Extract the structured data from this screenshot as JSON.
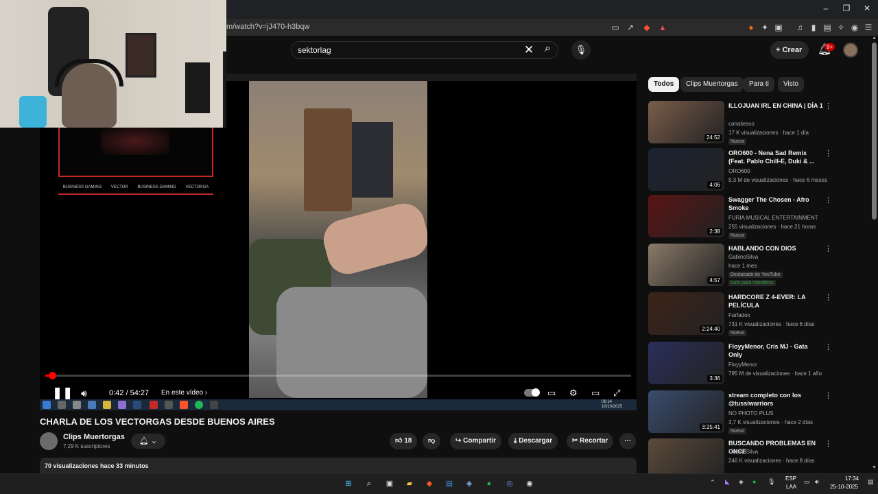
{
  "browser": {
    "url": "m/watch?v=jJ470-h3bqw",
    "bell_badge": "9+",
    "ext_badge": "1"
  },
  "youtube_header": {
    "search_value": "sektorlag",
    "create_label": "Crear",
    "notif_badge": "9+"
  },
  "player": {
    "time": "0:42 / 54:27",
    "chapter": "En este vídeo",
    "progress_fraction": 0.013,
    "overlay_socials": [
      "BUSINESS GAMING",
      "VECTOR",
      "BUSINESS GAMING",
      "VECTORGA"
    ],
    "mini_clock_time": "06:14",
    "mini_clock_date": "10/10/2025"
  },
  "video": {
    "title": "CHARLA DE LOS VECTORGAS DESDE BUENOS AIRES",
    "channel_name": "Clips Muertorgas",
    "subscribers": "7,29 K suscriptores",
    "likes": "18",
    "share_label": "Compartir",
    "download_label": "Descargar",
    "clip_label": "Recortar",
    "description_summary": "70 visualizaciones  hace 33 minutos"
  },
  "chips": [
    "Todos",
    "Clips Muertorgas",
    "Para ti",
    "Visto"
  ],
  "recommendations": [
    {
      "title": "ILLOJUAN IRL EN CHINA | DÍA 1",
      "channel": "canaliesco",
      "meta": "17 K visualizaciones · hace 1 día",
      "badge": "Nuevo",
      "duration": "24:52",
      "thumb_color": "#7a5d4a"
    },
    {
      "title": "ORO600 - Nena Sad Remix (Feat. Pablo Chill-E, Duki & ...",
      "channel": "ORO600",
      "meta": "9,3 M de visualizaciones · hace 6 meses",
      "badge": "",
      "duration": "4:06",
      "thumb_color": "#1b2233"
    },
    {
      "title": "Swagger The Chosen - Afro Smoke",
      "channel": "FURIA MUSICAL ENTERTAINMENT",
      "meta": "255 visualizaciones · hace 21 horas",
      "badge": "Nuevo",
      "duration": "2:38",
      "thumb_color": "#5a1414"
    },
    {
      "title": "HABLANDO CON DIOS",
      "channel": "GabinoSilva",
      "meta": "hace 1 mes",
      "badge": "Destacado de YouTube",
      "members": "Solo para miembros",
      "duration": "4:57",
      "thumb_color": "#8a7a68"
    },
    {
      "title": "HARDCORE Z 4-EVER: LA PELÍCULA",
      "channel": "Farfadox",
      "meta": "731 K visualizaciones · hace 6 días",
      "badge": "Nuevo",
      "duration": "2:24:40",
      "thumb_color": "#3d2418"
    },
    {
      "title": "FloyyMenor, Cris MJ - Gata Only",
      "channel": "FloyyMenor",
      "meta": "795 M de visualizaciones · hace 1 año",
      "badge": "",
      "duration": "3:36",
      "thumb_color": "#2a2f5a"
    },
    {
      "title": "stream completo con los @tussiwarriors",
      "channel": "NO PHOTO PLUS",
      "meta": "3,7 K visualizaciones · hace 2 días",
      "badge": "Nuevo",
      "duration": "3:25:41",
      "thumb_color": "#3a4c6e"
    },
    {
      "title": "BUSCANDO PROBLEMAS EN ONCE",
      "channel": "GabinoSilva",
      "meta": "246 K visualizaciones · hace 8 días",
      "badge": "",
      "duration": "",
      "thumb_color": "#5b4a3a"
    }
  ],
  "tray": {
    "lang1": "ESP",
    "lang2": "LAA",
    "time": "17:34",
    "date": "25-10-2025"
  },
  "colors": {
    "accent": "#ff0000",
    "background": "#0f0f0f",
    "chip_bg": "#272727"
  }
}
